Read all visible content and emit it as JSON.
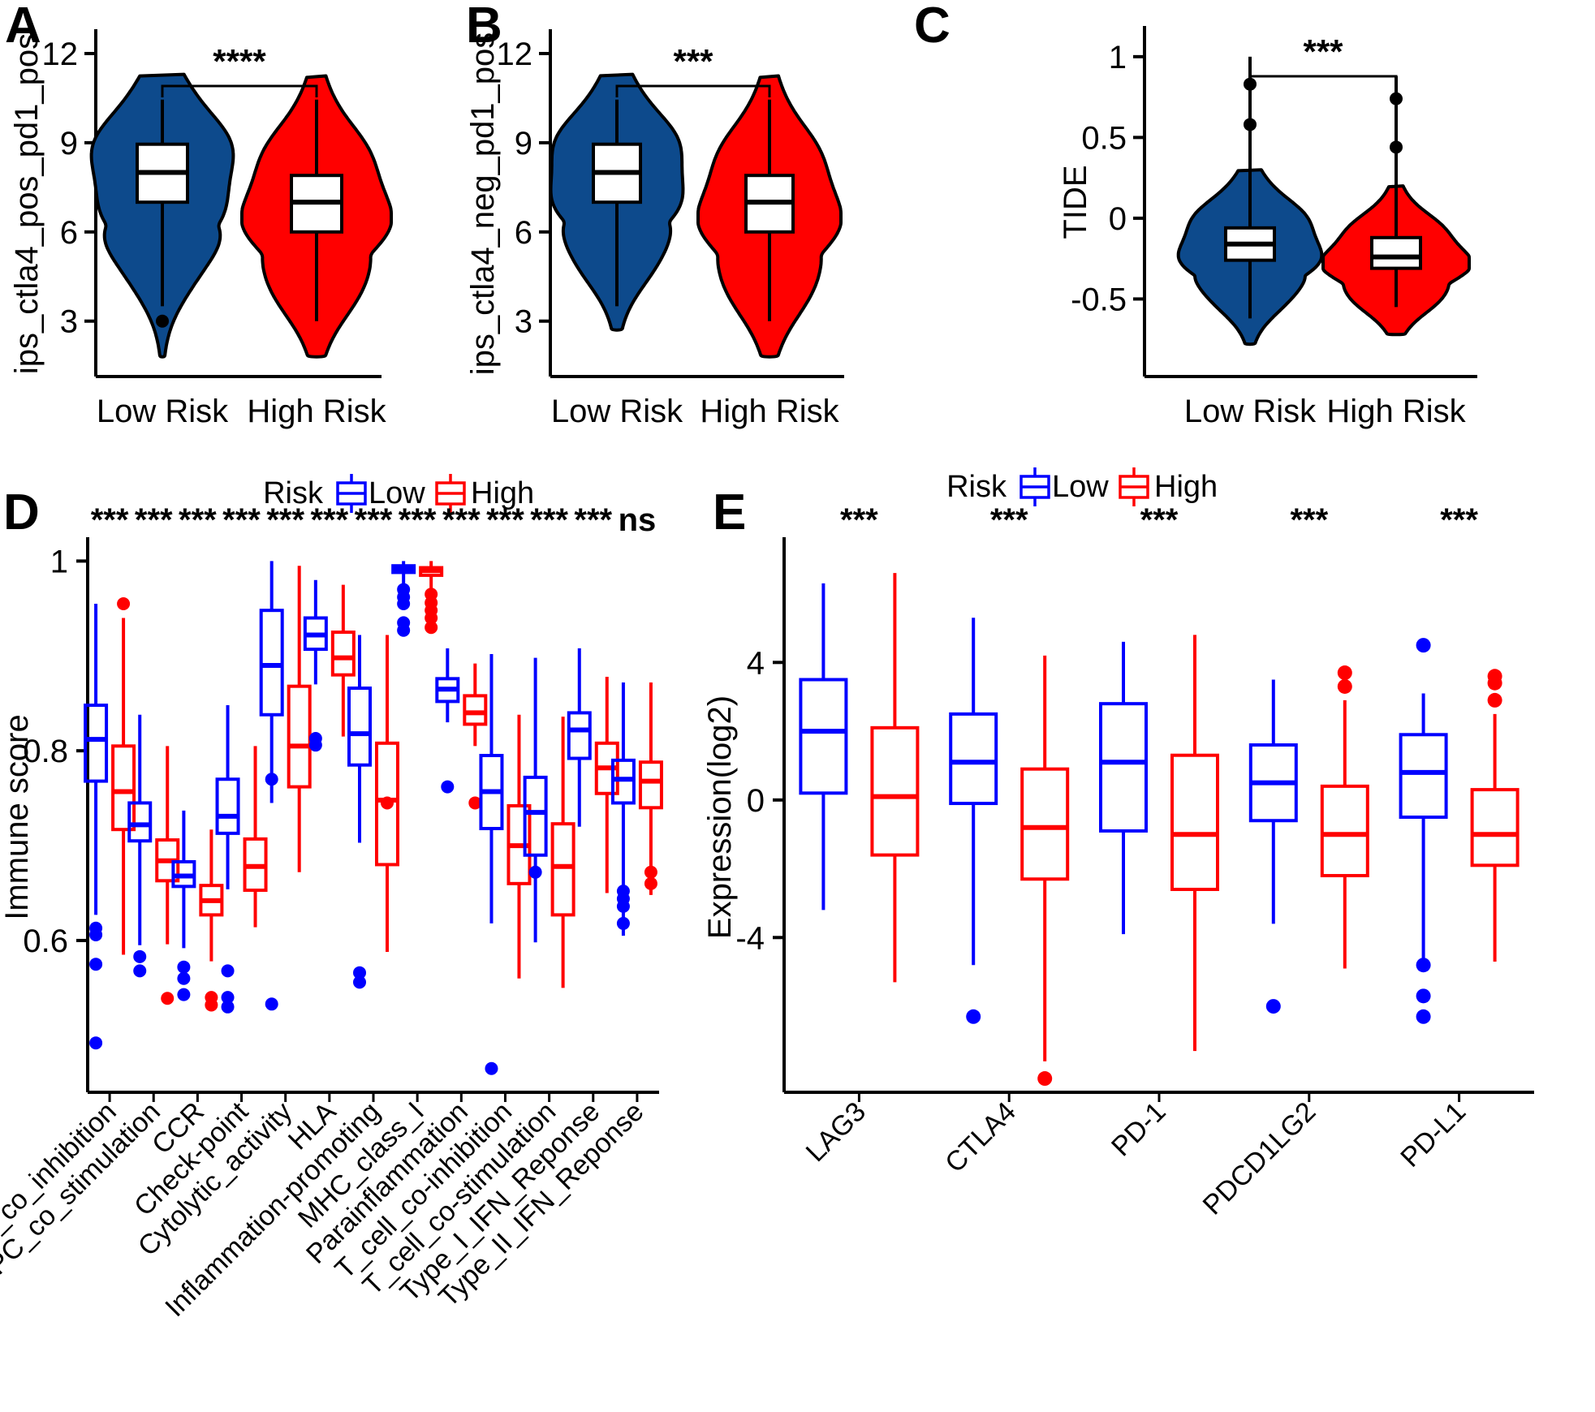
{
  "figure": {
    "panels": [
      "A",
      "B",
      "C",
      "D",
      "E"
    ],
    "colors": {
      "low_risk_fill": "#0D4A8C",
      "high_risk_fill": "#FF0000",
      "low_risk_line": "#0000FF",
      "high_risk_line": "#FF0000",
      "axis": "#000000",
      "box_fill": "#FFFFFF"
    }
  },
  "panelA": {
    "letter": "A",
    "ylabel": "ips_ctla4_pos_pd1_pos",
    "yticks": [
      "12",
      "9",
      "6",
      "3"
    ],
    "xticks": [
      "Low Risk",
      "High Risk"
    ],
    "significance": "****"
  },
  "panelB": {
    "letter": "B",
    "ylabel": "ips_ctla4_neg_pd1_pos",
    "yticks": [
      "12",
      "9",
      "6",
      "3"
    ],
    "xticks": [
      "Low Risk",
      "High Risk"
    ],
    "significance": "***"
  },
  "panelC": {
    "letter": "C",
    "ylabel": "TIDE",
    "yticks": [
      "1.0",
      "0.5",
      "0",
      "-0.5"
    ],
    "xticks": [
      "Low Risk",
      "High Risk"
    ],
    "significance": "***"
  },
  "panelD": {
    "letter": "D",
    "ylabel": "Immune score",
    "yticks": [
      "1.0",
      "0.8",
      "0.6"
    ],
    "legend": {
      "title": "Risk",
      "low": "Low",
      "high": "High"
    }
  },
  "panelE": {
    "letter": "E",
    "ylabel": "Expression(log2)",
    "yticks": [
      "4",
      "0",
      "-4"
    ],
    "legend": {
      "title": "Risk",
      "low": "Low",
      "high": "High"
    }
  },
  "chart_data": [
    {
      "panel": "A",
      "type": "violin",
      "title": "",
      "ylabel": "ips_ctla4_pos_pd1_pos",
      "xlabel": "",
      "ylim": [
        1.3,
        12.6
      ],
      "yticks": [
        12,
        9,
        6,
        3
      ],
      "categories": [
        "Low Risk",
        "High Risk"
      ],
      "annotation": "****",
      "series": [
        {
          "name": "Low Risk",
          "color": "#0D4A8C",
          "box": {
            "min": 3.5,
            "q1": 7.0,
            "median": 8.0,
            "q3": 8.95,
            "max": 10.45
          },
          "violin_range": [
            1.8,
            11.3
          ],
          "outliers": [
            3.0
          ]
        },
        {
          "name": "High Risk",
          "color": "#FF0000",
          "box": {
            "min": 3.0,
            "q1": 6.0,
            "median": 7.0,
            "q3": 7.9,
            "max": 10.45
          },
          "violin_range": [
            1.8,
            11.25
          ],
          "outliers": []
        }
      ]
    },
    {
      "panel": "B",
      "type": "violin",
      "title": "",
      "ylabel": "ips_ctla4_neg_pd1_pos",
      "xlabel": "",
      "ylim": [
        1.3,
        12.6
      ],
      "yticks": [
        12,
        9,
        6,
        3
      ],
      "categories": [
        "Low Risk",
        "High Risk"
      ],
      "annotation": "***",
      "series": [
        {
          "name": "Low Risk",
          "color": "#0D4A8C",
          "box": {
            "min": 3.5,
            "q1": 7.0,
            "median": 8.0,
            "q3": 8.95,
            "max": 10.45
          },
          "violin_range": [
            2.7,
            11.3
          ],
          "outliers": []
        },
        {
          "name": "High Risk",
          "color": "#FF0000",
          "box": {
            "min": 3.0,
            "q1": 6.0,
            "median": 7.0,
            "q3": 7.9,
            "max": 10.45
          },
          "violin_range": [
            1.8,
            11.25
          ],
          "outliers": []
        }
      ]
    },
    {
      "panel": "C",
      "type": "violin",
      "title": "",
      "ylabel": "TIDE",
      "xlabel": "",
      "ylim": [
        -0.95,
        1.15
      ],
      "yticks": [
        1.0,
        0.5,
        0,
        -0.5
      ],
      "categories": [
        "Low Risk",
        "High Risk"
      ],
      "annotation": "***",
      "series": [
        {
          "name": "Low Risk",
          "color": "#0D4A8C",
          "box": {
            "min": -0.62,
            "q1": -0.26,
            "median": -0.16,
            "q3": -0.06,
            "max": 1.0
          },
          "violin_range": [
            -0.78,
            0.3
          ],
          "outliers": [
            0.83,
            0.58
          ]
        },
        {
          "name": "High Risk",
          "color": "#FF0000",
          "box": {
            "min": -0.55,
            "q1": -0.31,
            "median": -0.24,
            "q3": -0.12,
            "max": 0.88
          },
          "violin_range": [
            -0.72,
            0.2
          ],
          "outliers": [
            0.74,
            0.44
          ]
        }
      ]
    },
    {
      "panel": "D",
      "type": "box",
      "title": "",
      "ylabel": "Immune score",
      "xlabel": "",
      "ylim": [
        0.44,
        1.02
      ],
      "yticks": [
        1.0,
        0.8,
        0.6
      ],
      "legend": {
        "title": "Risk",
        "entries": [
          "Low",
          "High"
        ],
        "position": "top"
      },
      "categories": [
        "APC_co_inhibition",
        "APC_co_stimulation",
        "CCR",
        "Check-point",
        "Cytolytic_activity",
        "HLA",
        "Inflammation-promoting",
        "MHC_class_I",
        "Parainflammation",
        "T_cell_co-inhibition",
        "T_cell_co-stimulation",
        "Type_I_IFN_Reponse",
        "Type_II_IFN_Reponse"
      ],
      "significance": [
        "***",
        "***",
        "***",
        "***",
        "***",
        "***",
        "***",
        "***",
        "***",
        "***",
        "***",
        "***",
        "ns"
      ],
      "series": [
        {
          "name": "Low",
          "color": "#0000FF",
          "boxes": [
            {
              "min": 0.627,
              "q1": 0.768,
              "median": 0.812,
              "q3": 0.848,
              "max": 0.955,
              "outliers": [
                0.613,
                0.606,
                0.575,
                0.492
              ]
            },
            {
              "min": 0.595,
              "q1": 0.705,
              "median": 0.722,
              "q3": 0.745,
              "max": 0.838,
              "outliers": [
                0.583,
                0.568
              ]
            },
            {
              "min": 0.592,
              "q1": 0.657,
              "median": 0.668,
              "q3": 0.683,
              "max": 0.737,
              "outliers": [
                0.572,
                0.56,
                0.543
              ]
            },
            {
              "min": 0.654,
              "q1": 0.713,
              "median": 0.731,
              "q3": 0.77,
              "max": 0.848,
              "outliers": [
                0.568,
                0.54,
                0.53
              ]
            },
            {
              "min": 0.745,
              "q1": 0.838,
              "median": 0.89,
              "q3": 0.948,
              "max": 1.0,
              "outliers": [
                0.77,
                0.533
              ]
            },
            {
              "min": 0.87,
              "q1": 0.907,
              "median": 0.922,
              "q3": 0.94,
              "max": 0.98,
              "outliers": [
                0.813,
                0.806
              ]
            },
            {
              "min": 0.703,
              "q1": 0.785,
              "median": 0.818,
              "q3": 0.866,
              "max": 0.922,
              "outliers": [
                0.566,
                0.556
              ]
            },
            {
              "min": 0.975,
              "q1": 0.988,
              "median": 0.992,
              "q3": 0.995,
              "max": 1.0,
              "outliers": [
                0.97,
                0.962,
                0.955,
                0.935,
                0.927
              ]
            },
            {
              "min": 0.83,
              "q1": 0.852,
              "median": 0.865,
              "q3": 0.876,
              "max": 0.908,
              "outliers": [
                0.762
              ]
            },
            {
              "min": 0.618,
              "q1": 0.718,
              "median": 0.757,
              "q3": 0.795,
              "max": 0.902,
              "outliers": [
                0.465
              ]
            },
            {
              "min": 0.598,
              "q1": 0.69,
              "median": 0.735,
              "q3": 0.772,
              "max": 0.898,
              "outliers": [
                0.672
              ]
            },
            {
              "min": 0.72,
              "q1": 0.792,
              "median": 0.822,
              "q3": 0.84,
              "max": 0.908,
              "outliers": []
            },
            {
              "min": 0.605,
              "q1": 0.745,
              "median": 0.77,
              "q3": 0.79,
              "max": 0.872,
              "outliers": [
                0.652,
                0.644,
                0.636,
                0.618
              ]
            }
          ]
        },
        {
          "name": "High",
          "color": "#FF0000",
          "boxes": [
            {
              "min": 0.585,
              "q1": 0.717,
              "median": 0.757,
              "q3": 0.805,
              "max": 0.94,
              "outliers": [
                0.955
              ]
            },
            {
              "min": 0.596,
              "q1": 0.663,
              "median": 0.684,
              "q3": 0.706,
              "max": 0.805,
              "outliers": [
                0.539
              ]
            },
            {
              "min": 0.578,
              "q1": 0.627,
              "median": 0.642,
              "q3": 0.658,
              "max": 0.717,
              "outliers": [
                0.54,
                0.532
              ]
            },
            {
              "min": 0.614,
              "q1": 0.653,
              "median": 0.678,
              "q3": 0.707,
              "max": 0.805,
              "outliers": []
            },
            {
              "min": 0.672,
              "q1": 0.762,
              "median": 0.805,
              "q3": 0.868,
              "max": 0.995,
              "outliers": []
            },
            {
              "min": 0.815,
              "q1": 0.88,
              "median": 0.898,
              "q3": 0.925,
              "max": 0.975,
              "outliers": []
            },
            {
              "min": 0.588,
              "q1": 0.68,
              "median": 0.748,
              "q3": 0.808,
              "max": 0.922,
              "outliers": [
                0.745
              ]
            },
            {
              "min": 0.97,
              "q1": 0.985,
              "median": 0.99,
              "q3": 0.993,
              "max": 1.0,
              "outliers": [
                0.965,
                0.956,
                0.948,
                0.94,
                0.93
              ]
            },
            {
              "min": 0.805,
              "q1": 0.828,
              "median": 0.84,
              "q3": 0.858,
              "max": 0.892,
              "outliers": [
                0.745
              ]
            },
            {
              "min": 0.56,
              "q1": 0.66,
              "median": 0.7,
              "q3": 0.742,
              "max": 0.838,
              "outliers": []
            },
            {
              "min": 0.55,
              "q1": 0.627,
              "median": 0.678,
              "q3": 0.723,
              "max": 0.836,
              "outliers": []
            },
            {
              "min": 0.65,
              "q1": 0.755,
              "median": 0.782,
              "q3": 0.808,
              "max": 0.878,
              "outliers": []
            },
            {
              "min": 0.648,
              "q1": 0.74,
              "median": 0.768,
              "q3": 0.788,
              "max": 0.872,
              "outliers": [
                0.672,
                0.66
              ]
            }
          ]
        }
      ]
    },
    {
      "panel": "E",
      "type": "box",
      "title": "",
      "ylabel": "Expression(log2)",
      "xlabel": "",
      "ylim": [
        -8.5,
        7.5
      ],
      "yticks": [
        4,
        0,
        -4
      ],
      "legend": {
        "title": "Risk",
        "entries": [
          "Low",
          "High"
        ],
        "position": "top"
      },
      "categories": [
        "LAG3",
        "CTLA4",
        "PD-1",
        "PDCD1LG2",
        "PD-L1"
      ],
      "significance": [
        "***",
        "***",
        "***",
        "***",
        "***"
      ],
      "series": [
        {
          "name": "Low",
          "color": "#0000FF",
          "boxes": [
            {
              "min": -3.2,
              "q1": 0.2,
              "median": 2.0,
              "q3": 3.5,
              "max": 6.3,
              "outliers": []
            },
            {
              "min": -4.8,
              "q1": -0.1,
              "median": 1.1,
              "q3": 2.5,
              "max": 5.3,
              "outliers": [
                -6.3
              ]
            },
            {
              "min": -3.9,
              "q1": -0.9,
              "median": 1.1,
              "q3": 2.8,
              "max": 4.6,
              "outliers": []
            },
            {
              "min": -3.6,
              "q1": -0.6,
              "median": 0.5,
              "q3": 1.6,
              "max": 3.5,
              "outliers": [
                -6.0
              ]
            },
            {
              "min": -4.6,
              "q1": -0.5,
              "median": 0.8,
              "q3": 1.9,
              "max": 3.1,
              "outliers": [
                4.5,
                -4.8,
                -5.7,
                -6.3
              ]
            }
          ]
        },
        {
          "name": "High",
          "color": "#FF0000",
          "boxes": [
            {
              "min": -5.3,
              "q1": -1.6,
              "median": 0.1,
              "q3": 2.1,
              "max": 6.6,
              "outliers": []
            },
            {
              "min": -7.6,
              "q1": -2.3,
              "median": -0.8,
              "q3": 0.9,
              "max": 4.2,
              "outliers": [
                -8.1
              ]
            },
            {
              "min": -7.3,
              "q1": -2.6,
              "median": -1.0,
              "q3": 1.3,
              "max": 4.8,
              "outliers": []
            },
            {
              "min": -4.9,
              "q1": -2.2,
              "median": -1.0,
              "q3": 0.4,
              "max": 2.9,
              "outliers": [
                3.7,
                3.3
              ]
            },
            {
              "min": -4.7,
              "q1": -1.9,
              "median": -1.0,
              "q3": 0.3,
              "max": 2.5,
              "outliers": [
                3.6,
                3.4,
                2.9
              ]
            }
          ]
        }
      ]
    }
  ]
}
